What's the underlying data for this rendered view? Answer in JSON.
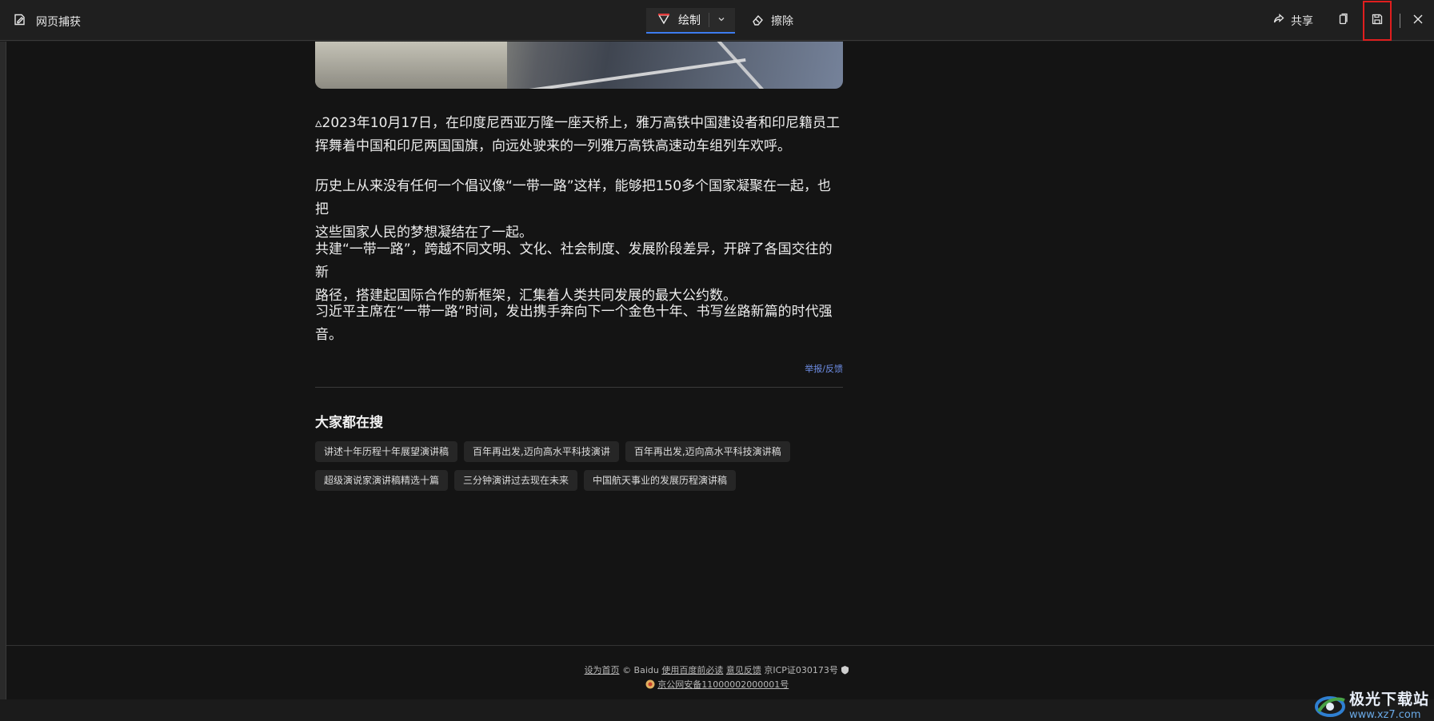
{
  "toolbar": {
    "title": "网页捕获",
    "draw_label": "绘制",
    "erase_label": "擦除",
    "share_label": "共享"
  },
  "article": {
    "paragraphs": [
      {
        "line1": "▵2023年10月17日，在印度尼西亚万隆一座天桥上，雅万高铁中国建设者和印尼籍员工",
        "line2": "挥舞着中国和印尼两国国旗，向远处驶来的一列雅万高铁高速动车组列车欢呼。"
      },
      {
        "line1": "历史上从来没有任何一个倡议像“一带一路”这样，能够把150多个国家凝聚在一起，也把",
        "line2": "这些国家人民的梦想凝结在了一起。"
      },
      {
        "line1": "共建“一带一路”，跨越不同文明、文化、社会制度、发展阶段差异，开辟了各国交往的新",
        "line2": "路径，搭建起国际合作的新框架，汇集着人类共同发展的最大公约数。"
      },
      {
        "line1": "习近平主席在“一带一路”时间，发出携手奔向下一个金色十年、书写丝路新篇的时代强",
        "line2": "音。"
      }
    ],
    "report_link": "举报/反馈"
  },
  "related": {
    "title": "大家都在搜",
    "tags": [
      "讲述十年历程十年展望演讲稿",
      "百年再出发,迈向高水平科技演讲",
      "百年再出发,迈向高水平科技演讲稿",
      "超级演说家演讲稿精选十篇",
      "三分钟演讲过去现在未来",
      "中国航天事业的发展历程演讲稿"
    ]
  },
  "footer": {
    "set_home": "设为首页",
    "copyright": "© Baidu",
    "must_read": "使用百度前必读",
    "feedback": "意见反馈",
    "icp": "京ICP证030173号",
    "police": "京公网安备11000002000001号"
  },
  "watermark": {
    "main": "极光下载站",
    "sub": "www.xz7.com"
  }
}
